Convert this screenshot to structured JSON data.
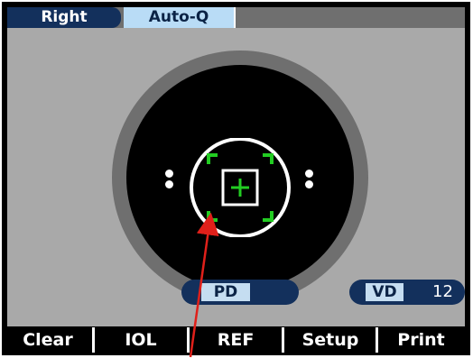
{
  "header": {
    "eye_label": "Right",
    "mode_label": "Auto-Q"
  },
  "measurements": {
    "pd_label": "PD",
    "pd_value": "",
    "vd_label": "VD",
    "vd_value": "12"
  },
  "softkeys": [
    {
      "label": "Clear"
    },
    {
      "label": "IOL"
    },
    {
      "label": "REF"
    },
    {
      "label": "Setup"
    },
    {
      "label": "Print"
    }
  ],
  "colors": {
    "target_green": "#22cc22",
    "tab_navy": "#13305c",
    "tab_light_blue": "#b9dcf6",
    "pointer_red": "#e0201a"
  },
  "icons": {
    "center_target": "crosshair-icon",
    "focus_brackets": "focus-brackets-icon",
    "alignment_dots": "alignment-dots-icon"
  }
}
